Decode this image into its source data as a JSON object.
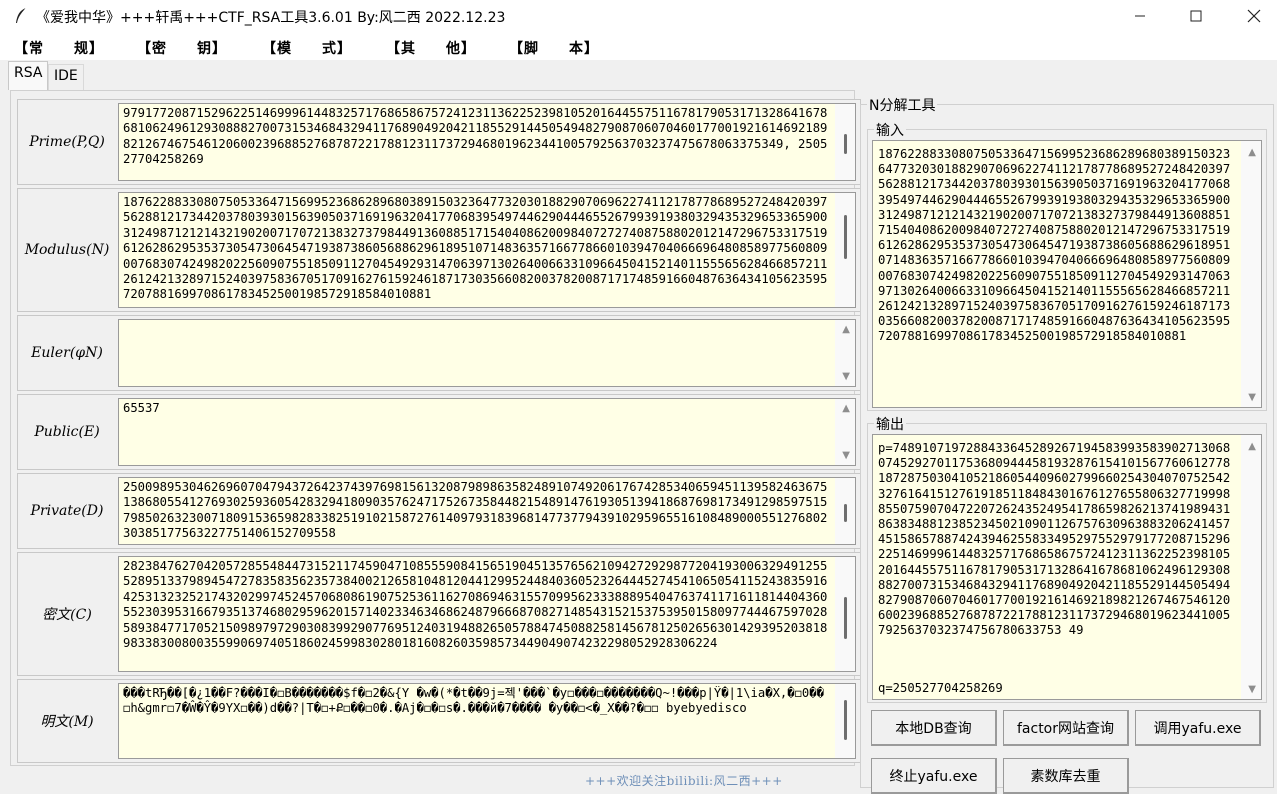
{
  "window": {
    "title": "《爱我中华》+++轩禹+++CTF_RSA工具3.6.01   By:风二西 2022.12.23",
    "minimize": "─",
    "maximize": "☐",
    "close": "✕"
  },
  "menu": [
    "【常　　规】",
    "【密　　钥】",
    "【模　　式】",
    "【其　　他】",
    "【脚　　本】"
  ],
  "tabs": [
    "RSA",
    "IDE"
  ],
  "fields": {
    "prime": {
      "label": "Prime(P,Q)",
      "value": "979177208715296225146999614483257176865867572412311362252398105201644557511678179053171328641678681062496129308882700731534684329411768904920421185529144505494827908706070460177001921614692189821267467546120600239688527687872217881231173729468019623441005792563703237475678063375349, 250527704258269"
    },
    "modulus": {
      "label": "Modulus(N)",
      "value": "187622883308075053364715699523686289680389150323647732030188290706962274112178778689527248420397562881217344203780393015639050371691963204177068395497446290444655267993919380329435329653365900312498712121432190200717072138327379844913608851715404086200984072727408758802012147296753317519612628629535373054730645471938738605688629618951071483635716677866010394704066696480858977560809007683074249820225609075518509112704549293147063971302640066331096645041521401155565628466857211261242132897152403975836705170916276159246187173035660820037820087171748591660487636434105623595720788169970861783452500198572918584010881"
    },
    "euler": {
      "label": "Euler(φN)",
      "value": ""
    },
    "public": {
      "label": "Public(E)",
      "value": "65537"
    },
    "private": {
      "label": "Private(D)",
      "value": "25009895304626960704794372642374397698156132087989863582489107492061767428534065945113958246367513868055412769302593605428329418090357624717526735844821548914761930513941868769817349129859751579850263230071809153659828338251910215872761409793183968147737794391029596551610848900055127680230385177563227751406152709558"
    },
    "cipher": {
      "label": "密文(C)",
      "value": "282384762704205728554844731521174590471085559084156519045135765621094272929877204193006329491255528951337989454727835835623573840021265810481204412995244840360523264445274541065054115243835916425313232521743202997452457068086190752536116270869463155709956233388895404763741171611814404360552303953166793513746802959620157140233463468624879666870827148543152153753950158097744467597028589384771705215098979729030839929077695124031948826505788474508825814567812502656301429395203818983383008003559906974051860245998302801816082603598573449049074232298052928306224"
    },
    "plain": {
      "label": "明文(M)",
      "value": "���tRЂ��[�¿1��F?���I�◻B�������$f�◻2�&{Y �w�(*�t��9j=젝'���`�y◻���◻�������Q~!���p|Ÿ�|1\\ia�X,�◻0��◻h&gmr◻7�Ŵ�Ŷ�9YX◻��)d��?|T�◻+Ք◻��◻0�.�Aj�◻�◻s�.���й�7����  �y��◻<�_X��?�◻◻ byebyedisco"
    }
  },
  "footer_note": "+++欢迎关注bilibili:风二西+++",
  "right": {
    "group_title": "N分解工具",
    "input_title": "输入",
    "input_value": "187622883308075053364715699523686289680389150323647732030188290706962274112178778689527248420397562881217344203780393015639050371691963204177068395497446290444655267993919380329435329653365900312498712121432190200717072138327379844913608851715404086200984072727408758802012147296753317519612628629535373054730645471938738605688629618951071483635716677866010394704066696480858977560809007683074249820225609075518509112704549293147063971302640066331096645041521401155565628466857211261242132897152403975836705170916276159246187173035660820037820087171748591660487636434105623595720788169970861783452500198572918584010881",
    "output_title": "输出",
    "output_value": "p=74891071972884336452892671945839935839027130680745292701175368094445819328761541015677606127781872875030410521860544096027996602543040707525423276164151276191851184843016761276558063277199988550759070472207262435249541786598262137419894318638348812385234502109011267576309638832062414574515865788742439462558334952975529791772087152962251469996144832571768658675724123113622523981052016445575116781790531713286416786810624961293088827007315346843294117689049204211855291445054948279087060704601770019216146921898212674675461206002396885276878722178812311737294680196234410057925637032374756780633753 49",
    "output_q": "q=250527704258269",
    "buttons": {
      "db_query": "本地DB查询",
      "factor_query": "factor网站查询",
      "yafu_call": "调用yafu.exe",
      "yafu_stop": "终止yafu.exe",
      "prime_dedup": "素数库去重"
    }
  },
  "colors": {
    "textbox_bg": "#ffffe6",
    "footer_note": "#6e8fb8"
  }
}
